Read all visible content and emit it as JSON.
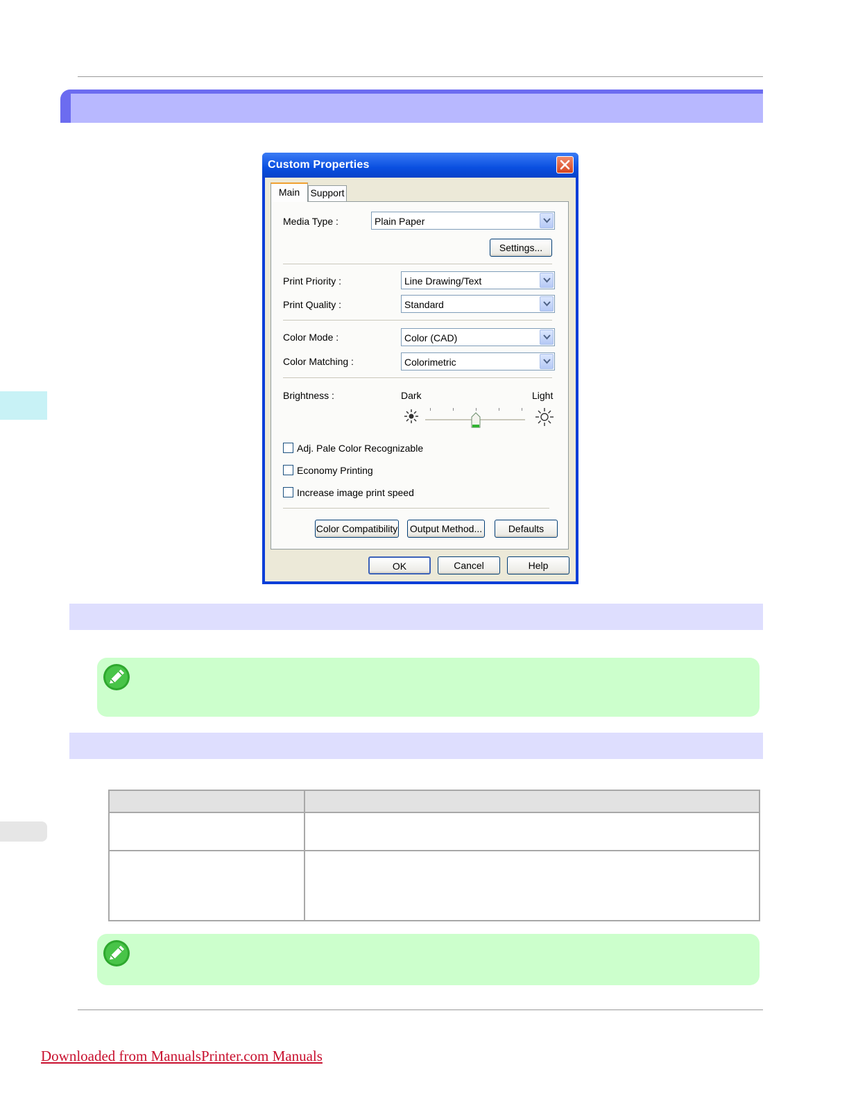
{
  "dialog": {
    "title": "Custom Properties",
    "tabs": [
      {
        "label": "Main"
      },
      {
        "label": "Support"
      }
    ],
    "media_type_label": "Media Type :",
    "media_type_value": "Plain Paper",
    "settings_button": "Settings...",
    "print_priority_label": "Print Priority :",
    "print_priority_value": "Line Drawing/Text",
    "print_quality_label": "Print Quality :",
    "print_quality_value": "Standard",
    "color_mode_label": "Color Mode :",
    "color_mode_value": "Color (CAD)",
    "color_matching_label": "Color Matching :",
    "color_matching_value": "Colorimetric",
    "brightness_label": "Brightness :",
    "brightness_dark": "Dark",
    "brightness_light": "Light",
    "brightness_level": 0.5,
    "checkboxes": [
      {
        "label": "Adj. Pale Color Recognizable",
        "checked": false
      },
      {
        "label": "Economy Printing",
        "checked": false
      },
      {
        "label": "Increase image print speed",
        "checked": false
      }
    ],
    "color_compat_button": "Color Compatibility",
    "output_method_button": "Output Method...",
    "defaults_button": "Defaults",
    "ok_button": "OK",
    "cancel_button": "Cancel",
    "help_button": "Help"
  },
  "footer": {
    "link_text": "Downloaded from ManualsPrinter.com Manuals"
  },
  "colors": {
    "header_band": "#6c6cf0",
    "header_inner": "#b8b8ff",
    "section_band": "#dedefe",
    "note_bg": "#ccffcc",
    "link": "#c8102e"
  }
}
